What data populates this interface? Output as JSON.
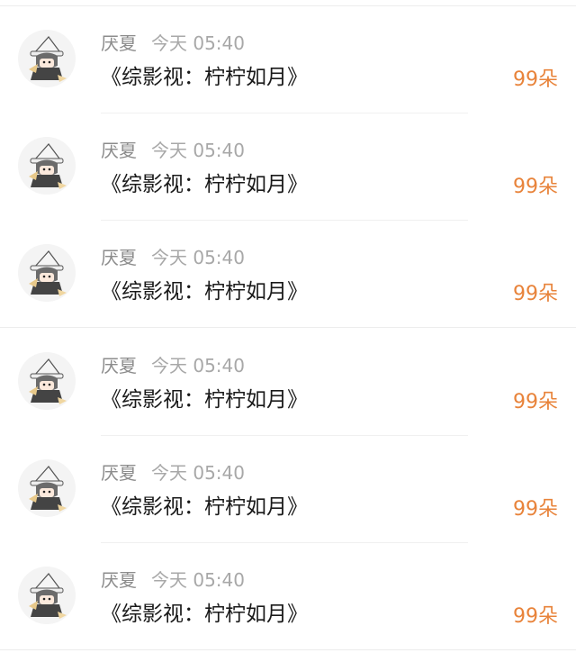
{
  "entries": [
    {
      "name": "厌夏",
      "time": "今天 05:40",
      "title": "《综影视：柠柠如月》",
      "flowers": "99朵"
    },
    {
      "name": "厌夏",
      "time": "今天 05:40",
      "title": "《综影视：柠柠如月》",
      "flowers": "99朵"
    },
    {
      "name": "厌夏",
      "time": "今天 05:40",
      "title": "《综影视：柠柠如月》",
      "flowers": "99朵"
    },
    {
      "name": "厌夏",
      "time": "今天 05:40",
      "title": "《综影视：柠柠如月》",
      "flowers": "99朵"
    },
    {
      "name": "厌夏",
      "time": "今天 05:40",
      "title": "《综影视：柠柠如月》",
      "flowers": "99朵"
    },
    {
      "name": "厌夏",
      "time": "今天 05:40",
      "title": "《综影视：柠柠如月》",
      "flowers": "99朵"
    }
  ],
  "colors": {
    "name": "#8c8c8c",
    "time": "#a8a8a8",
    "title": "#1a1a1a",
    "flowers": "#e8833a"
  }
}
